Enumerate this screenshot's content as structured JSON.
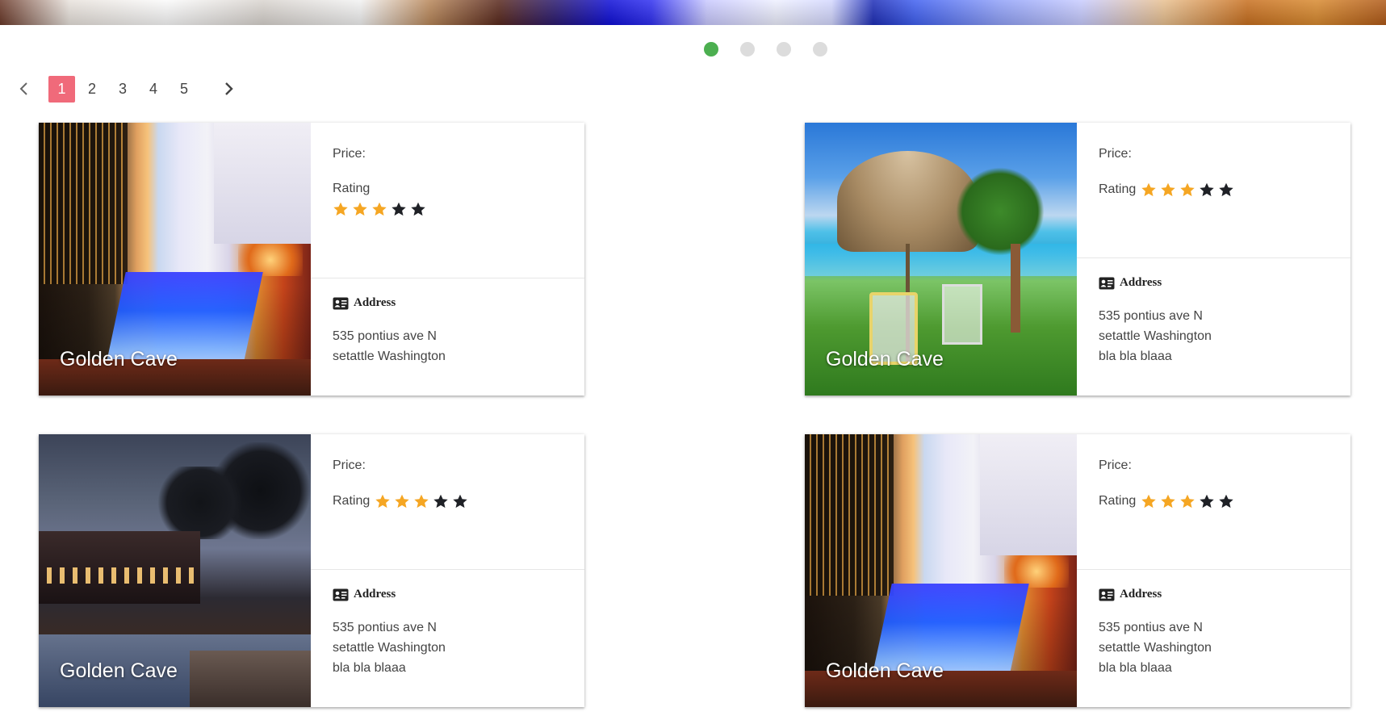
{
  "carousel": {
    "dots": [
      {
        "state": "active"
      },
      {
        "state": "inactive"
      },
      {
        "state": "inactive"
      },
      {
        "state": "inactive"
      }
    ],
    "active_color": "#4caf50",
    "inactive_color": "#dcdcdc"
  },
  "pagination": {
    "prev_icon": "chevron-left-icon",
    "next_icon": "chevron-right-icon",
    "pages": [
      "1",
      "2",
      "3",
      "4",
      "5"
    ],
    "current": "1",
    "current_color": "#f06a7a"
  },
  "cards": [
    {
      "title": "Golden Cave",
      "scene": "city-pool",
      "price_label": "Price:",
      "rating_label": "Rating",
      "rating": 3,
      "rating_max": 5,
      "address_label": "Address",
      "address_lines": [
        "535 pontius ave N",
        "setattle Washington"
      ]
    },
    {
      "title": "Golden Cave",
      "scene": "beach-pool",
      "price_label": "Price:",
      "rating_label": "Rating",
      "rating": 3,
      "rating_max": 5,
      "address_label": "Address",
      "address_lines": [
        "535 pontius ave N",
        "setattle Washington",
        "bla bla blaaa"
      ]
    },
    {
      "title": "Golden Cave",
      "scene": "night-resort",
      "price_label": "Price:",
      "rating_label": "Rating",
      "rating": 3,
      "rating_max": 5,
      "address_label": "Address",
      "address_lines": [
        "535 pontius ave N",
        "setattle Washington",
        "bla bla blaaa"
      ]
    },
    {
      "title": "Golden Cave",
      "scene": "city-pool",
      "price_label": "Price:",
      "rating_label": "Rating",
      "rating": 3,
      "rating_max": 5,
      "address_label": "Address",
      "address_lines": [
        "535 pontius ave N",
        "setattle Washington",
        "bla bla blaaa"
      ]
    }
  ],
  "colors": {
    "star_filled": "#f5a623",
    "star_empty": "#1f2126"
  }
}
